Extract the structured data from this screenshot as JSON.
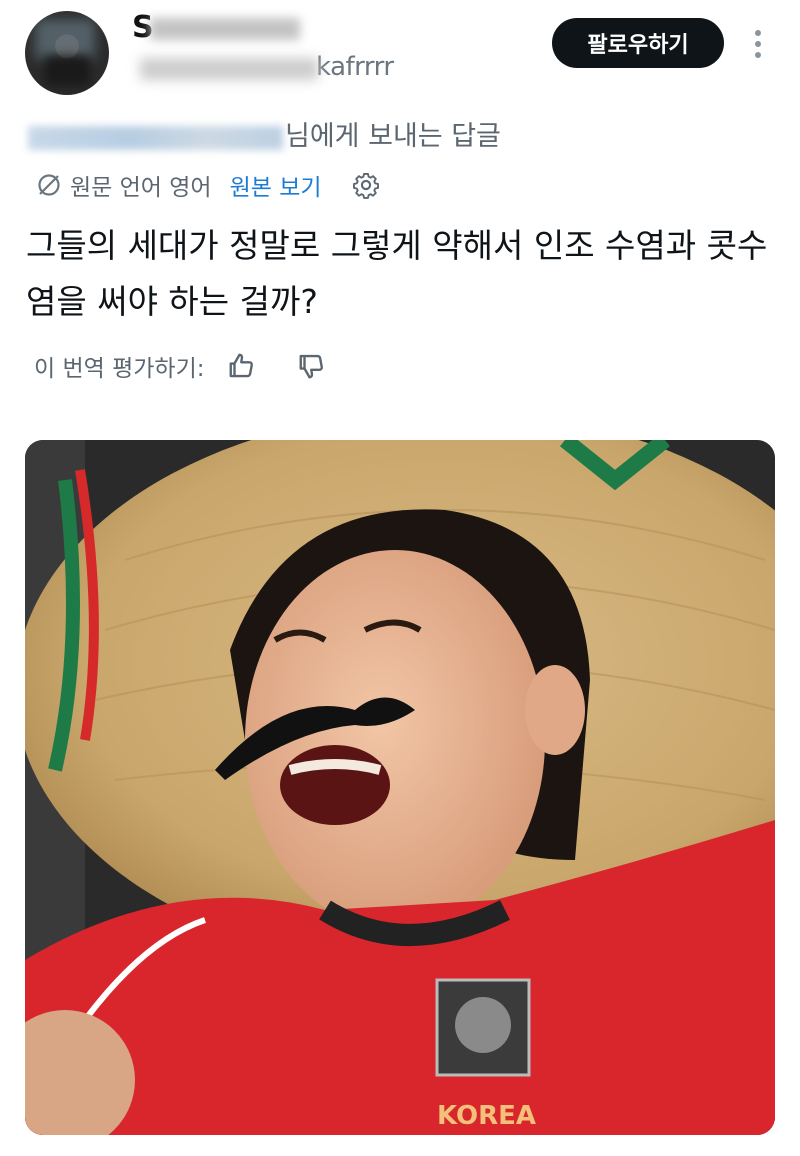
{
  "header": {
    "name_visible": "S",
    "handle_visible": "kafrrrr",
    "follow_label": "팔로우하기",
    "more_icon": "more-vertical-icon"
  },
  "reply": {
    "suffix": "님에게 보내는 답글"
  },
  "translation": {
    "source_language": "원문 언어 영어",
    "view_original": "원본 보기",
    "icons": [
      "translate-slash-icon",
      "gear-icon"
    ]
  },
  "tweet": {
    "text": "그들의 세대가 정말로 그렇게 약해서 인조 수염과 콧수염을 써야 하는 걸까?"
  },
  "rating": {
    "label": "이 번역 평가하기:",
    "icons": [
      "thumbs-up-icon",
      "thumbs-down-icon"
    ]
  },
  "media": {
    "jersey_text": "KOREA"
  },
  "colors": {
    "accent": "#1d7bd6",
    "button_bg": "#0f1419",
    "jersey_red": "#d8262c",
    "hat_straw": "#c9a66b"
  }
}
